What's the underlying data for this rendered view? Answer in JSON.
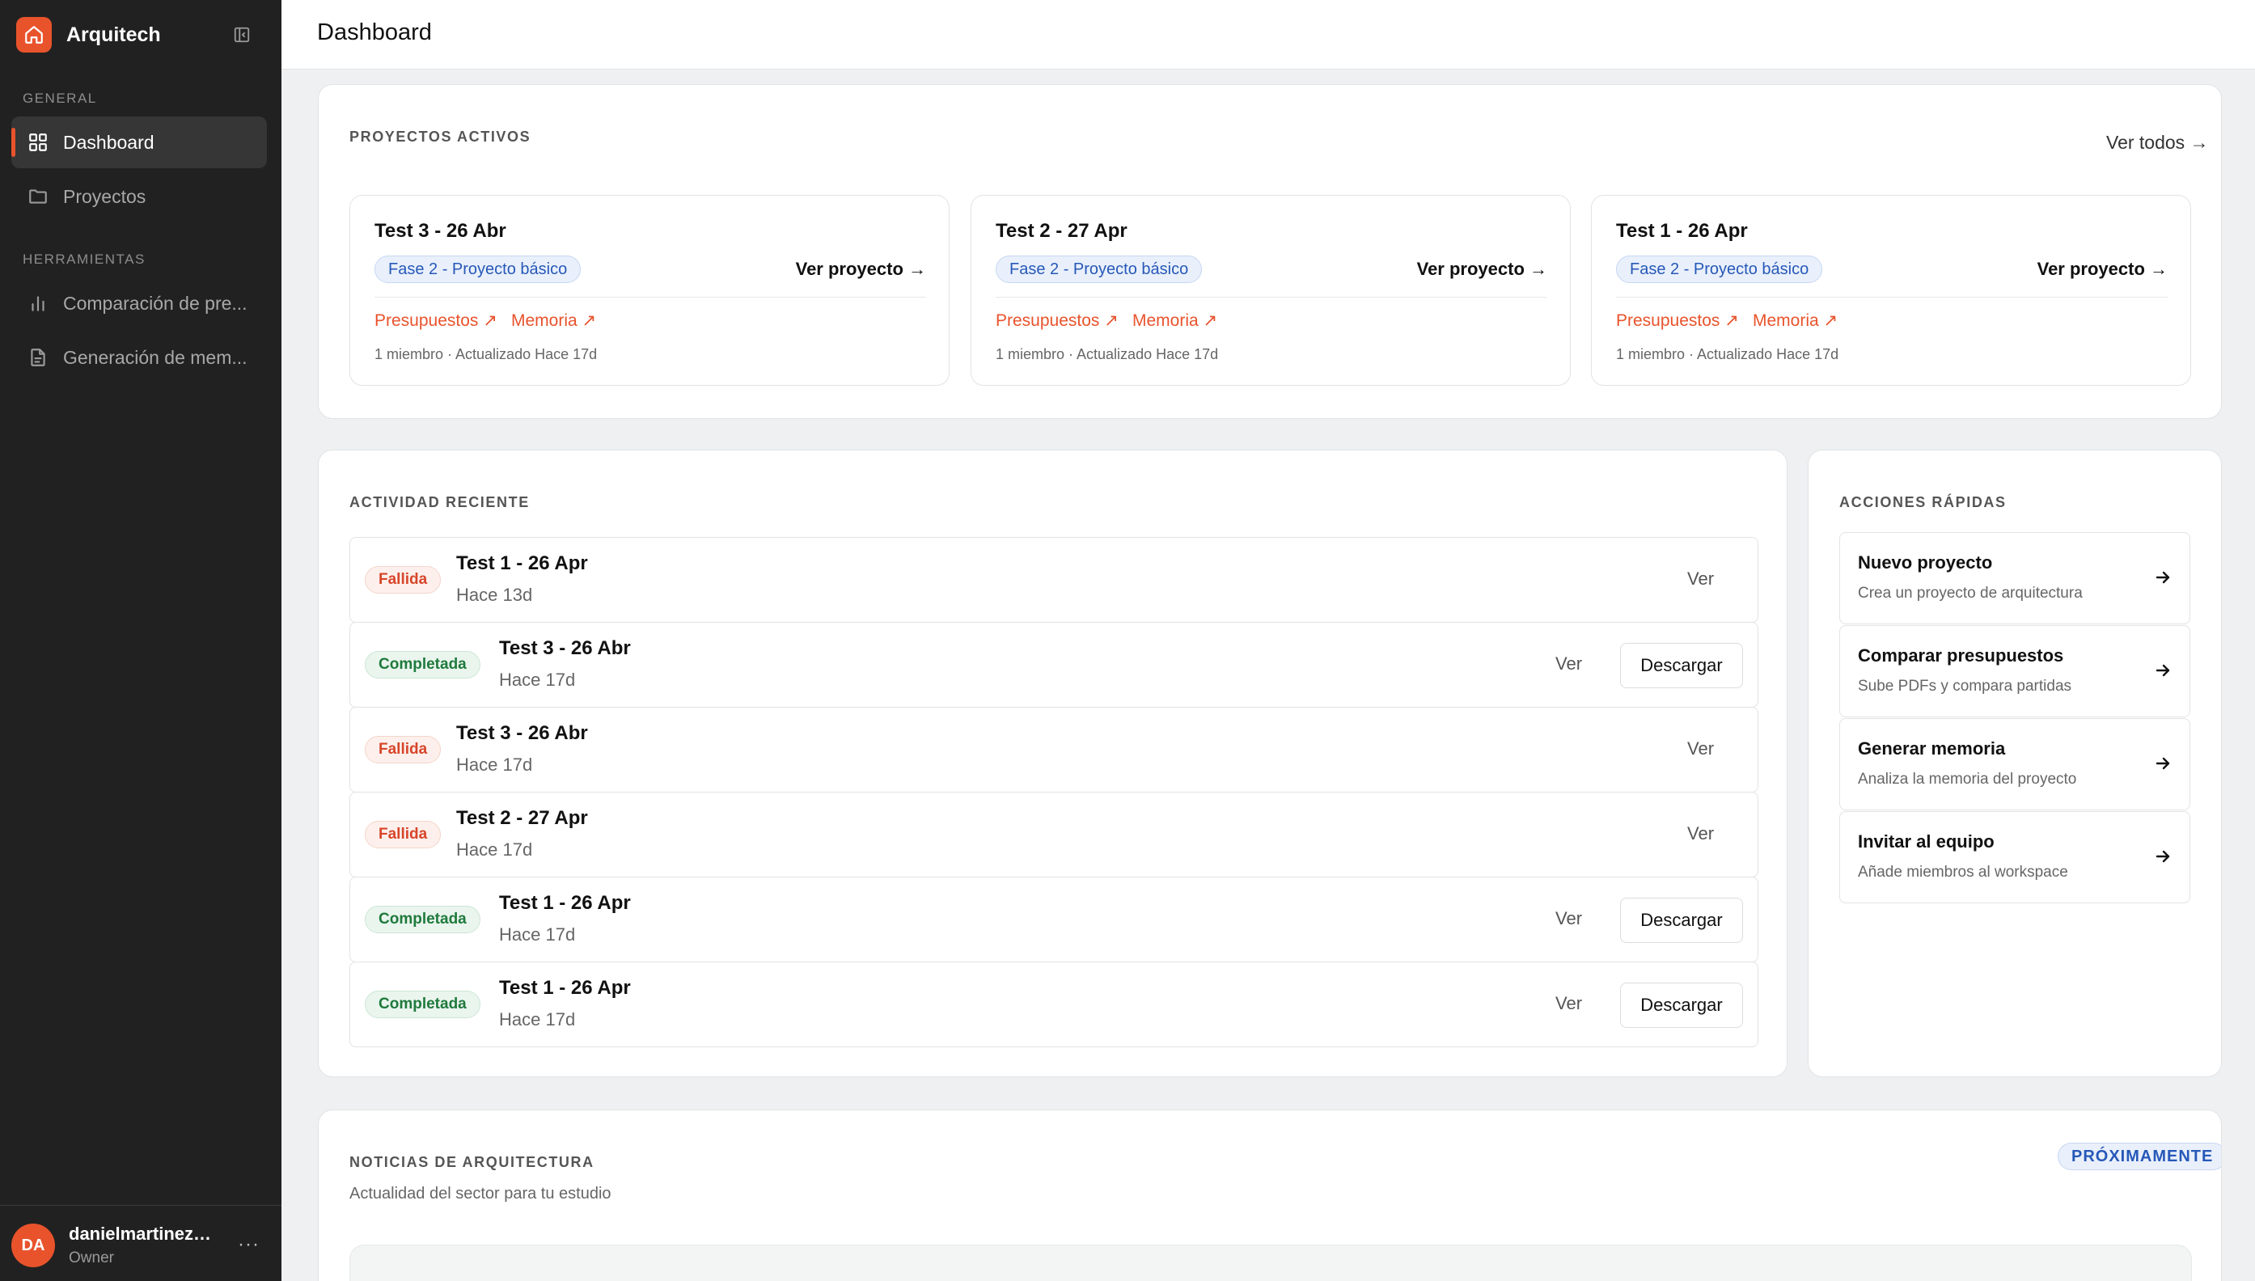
{
  "app": {
    "name": "Arquitech",
    "logo_icon": "home-icon"
  },
  "sidebar": {
    "sections": [
      {
        "label": "GENERAL",
        "items": [
          {
            "label": "Dashboard",
            "icon": "grid-icon",
            "active": true
          },
          {
            "label": "Proyectos",
            "icon": "folder-icon",
            "active": false
          }
        ]
      },
      {
        "label": "HERRAMIENTAS",
        "items": [
          {
            "label": "Comparación de pre...",
            "icon": "bar-chart-icon",
            "active": false
          },
          {
            "label": "Generación de mem...",
            "icon": "document-icon",
            "active": false
          }
        ]
      }
    ],
    "user": {
      "initials": "DA",
      "name": "danielmartinezb...",
      "role": "Owner",
      "menu": "···"
    }
  },
  "header": {
    "title": "Dashboard"
  },
  "active_projects": {
    "title": "PROYECTOS ACTIVOS",
    "see_all": "Ver todos →",
    "projects": [
      {
        "name": "Test 3 - 26 Abr",
        "phase": "Fase 2 - Proyecto básico",
        "link": "Ver proyecto →",
        "budgets": "Presupuestos ↗",
        "memory": "Memoria ↗",
        "meta": "1 miembro · Actualizado Hace 17d"
      },
      {
        "name": "Test 2 - 27 Apr",
        "phase": "Fase 2 - Proyecto básico",
        "link": "Ver proyecto →",
        "budgets": "Presupuestos ↗",
        "memory": "Memoria ↗",
        "meta": "1 miembro · Actualizado Hace 17d"
      },
      {
        "name": "Test 1 - 26 Apr",
        "phase": "Fase 2 - Proyecto básico",
        "link": "Ver proyecto →",
        "budgets": "Presupuestos ↗",
        "memory": "Memoria ↗",
        "meta": "1 miembro · Actualizado Hace 17d"
      }
    ]
  },
  "recent_activity": {
    "title": "ACTIVIDAD RECIENTE",
    "rows": [
      {
        "status": "Fallida",
        "name": "Test 1 - 26 Apr",
        "time": "Hace 13d",
        "view": "Ver",
        "download": ""
      },
      {
        "status": "Completada",
        "name": "Test 3 - 26 Abr",
        "time": "Hace 17d",
        "view": "Ver",
        "download": "Descargar"
      },
      {
        "status": "Fallida",
        "name": "Test 3 - 26 Abr",
        "time": "Hace 17d",
        "view": "Ver",
        "download": ""
      },
      {
        "status": "Fallida",
        "name": "Test 2 - 27 Apr",
        "time": "Hace 17d",
        "view": "Ver",
        "download": ""
      },
      {
        "status": "Completada",
        "name": "Test 1 - 26 Apr",
        "time": "Hace 17d",
        "view": "Ver",
        "download": "Descargar"
      },
      {
        "status": "Completada",
        "name": "Test 1 - 26 Apr",
        "time": "Hace 17d",
        "view": "Ver",
        "download": "Descargar"
      }
    ]
  },
  "quick_actions": {
    "title": "ACCIONES RÁPIDAS",
    "items": [
      {
        "title": "Nuevo proyecto",
        "desc": "Crea un proyecto de arquitectura"
      },
      {
        "title": "Comparar presupuestos",
        "desc": "Sube PDFs y compara partidas"
      },
      {
        "title": "Generar memoria",
        "desc": "Analiza la memoria del proyecto"
      },
      {
        "title": "Invitar al equipo",
        "desc": "Añade miembros al workspace"
      }
    ]
  },
  "news": {
    "title": "NOTICIAS DE ARQUITECTURA",
    "badge": "PRÓXIMAMENTE",
    "subtitle": "Actualidad del sector para tu estudio"
  },
  "colors": {
    "accent": "#e8532c",
    "sidebar_bg": "#212121",
    "phase_blue": "#2758b8",
    "success": "#1f7a3c",
    "danger": "#d7452a"
  }
}
